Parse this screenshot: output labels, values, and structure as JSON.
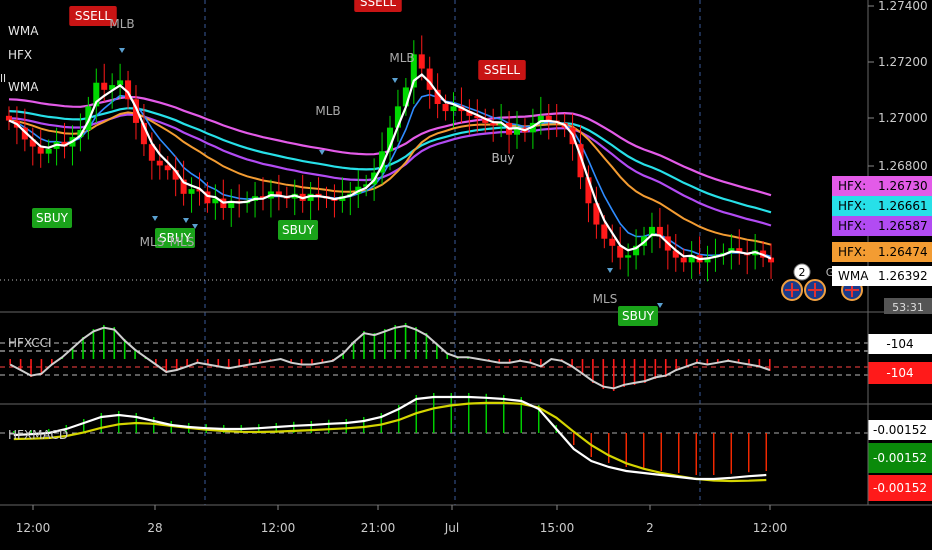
{
  "legend": {
    "line1": "WMA",
    "line2": "HFX",
    "line3": "WMA",
    "clipped": "ll"
  },
  "colors": {
    "bg": "#000000",
    "up": "#00d800",
    "down": "#ff1a1a",
    "wma_white": "#ffffff",
    "ema_blue": "#2f8cff",
    "ema_orange": "#f39c32",
    "ema_purple": "#b24bf3",
    "ema_pink": "#e35be8",
    "ema_cyan": "#27e0e8",
    "signal_sell": "#c81414",
    "signal_buy": "#1aa31a",
    "grid_dash": "#3a5a9a"
  },
  "price_axis": {
    "ticks": [
      "1.27400",
      "1.27200",
      "1.27000",
      "1.26800"
    ],
    "badges": [
      {
        "label": "HFX:",
        "value": "1.26730",
        "color": "#e35be8",
        "text": "#000"
      },
      {
        "label": "HFX:",
        "value": "1.26661",
        "color": "#27e0e8",
        "text": "#000"
      },
      {
        "label": "HFX:",
        "value": "1.26587",
        "color": "#b24bf3",
        "text": "#000"
      },
      {
        "label": "HFX:",
        "value": "1.26474",
        "color": "#f39c32",
        "text": "#000"
      },
      {
        "label": "WMA",
        "value": "1.26392",
        "color": "#ffffff",
        "text": "#000"
      }
    ],
    "countdown": "53:31"
  },
  "signals": [
    {
      "type": "SSELL",
      "kind": "sell"
    },
    {
      "type": "SSELL",
      "kind": "sell"
    },
    {
      "type": "SSELL",
      "kind": "sell"
    },
    {
      "type": "SBUY",
      "kind": "buy"
    },
    {
      "type": "SBUY",
      "kind": "buy"
    },
    {
      "type": "SBUY",
      "kind": "buy"
    },
    {
      "type": "SBUY",
      "kind": "buy"
    }
  ],
  "mlb_labels": [
    "MLB",
    "MLB",
    "MLB",
    "MLS",
    "MLS",
    "MLS"
  ],
  "buy_label": "Buy",
  "event_badge": "2",
  "event_badge_2": "G",
  "cci_panel": {
    "name": "HFXCCI",
    "scale": [
      "-104",
      "-104"
    ]
  },
  "macd_panel": {
    "name": "HFXMACD",
    "scale": [
      "-0.00152",
      "-0.00152",
      "-0.00152"
    ]
  },
  "time_axis": [
    "12:00",
    "28",
    "12:00",
    "21:00",
    "Jul",
    "15:00",
    "2",
    "12:00"
  ],
  "chart_data": {
    "type": "candlestick",
    "title": "",
    "ylabel": "",
    "ylim": [
      1.2618,
      1.275
    ],
    "closes": [
      1.2699,
      1.2696,
      1.2691,
      1.2688,
      1.2685,
      1.2687,
      1.269,
      1.2688,
      1.2692,
      1.2695,
      1.2705,
      1.2715,
      1.2712,
      1.2714,
      1.2716,
      1.2708,
      1.2698,
      1.2689,
      1.2682,
      1.268,
      1.2678,
      1.2674,
      1.2668,
      1.267,
      1.2669,
      1.2664,
      1.2666,
      1.2662,
      1.2665,
      1.2664,
      1.2665,
      1.2667,
      1.2666,
      1.2669,
      1.2667,
      1.2666,
      1.2668,
      1.2665,
      1.2668,
      1.2667,
      1.2666,
      1.2665,
      1.2667,
      1.2668,
      1.2671,
      1.2672,
      1.2677,
      1.2686,
      1.2696,
      1.2705,
      1.2713,
      1.2727,
      1.2721,
      1.2712,
      1.2706,
      1.2703,
      1.2705,
      1.2703,
      1.2701,
      1.27,
      1.2698,
      1.2697,
      1.2698,
      1.2693,
      1.2696,
      1.2694,
      1.2698,
      1.2701,
      1.2699,
      1.2698,
      1.2696,
      1.2689,
      1.2675,
      1.2664,
      1.2655,
      1.2649,
      1.2646,
      1.2641,
      1.2642,
      1.2646,
      1.265,
      1.2654,
      1.265,
      1.2644,
      1.2641,
      1.2639,
      1.2642,
      1.2639,
      1.2641,
      1.2642,
      1.2643,
      1.2645,
      1.2643,
      1.2642,
      1.2644,
      1.2641,
      1.2639
    ],
    "cci": [
      -0.3,
      -0.6,
      -0.9,
      -0.8,
      -0.3,
      0.1,
      0.6,
      1.1,
      1.5,
      1.7,
      1.6,
      1.0,
      0.5,
      0.1,
      -0.3,
      -0.7,
      -0.6,
      -0.4,
      -0.2,
      -0.3,
      -0.4,
      -0.5,
      -0.4,
      -0.3,
      -0.2,
      -0.1,
      0.0,
      -0.2,
      -0.3,
      -0.3,
      -0.2,
      -0.1,
      0.3,
      0.9,
      1.4,
      1.3,
      1.5,
      1.7,
      1.8,
      1.6,
      1.3,
      0.8,
      0.3,
      0.1,
      0.1,
      0.0,
      -0.1,
      -0.2,
      -0.2,
      -0.1,
      -0.2,
      -0.4,
      0.0,
      -0.1,
      -0.4,
      -0.8,
      -1.2,
      -1.5,
      -1.6,
      -1.4,
      -1.3,
      -1.2,
      -1.0,
      -0.9,
      -0.6,
      -0.4,
      -0.2,
      -0.3,
      -0.2,
      -0.1,
      -0.2,
      -0.3,
      -0.4,
      -0.6
    ],
    "macd": [
      0.05,
      0.07,
      0.1,
      0.2,
      0.35,
      0.5,
      0.55,
      0.5,
      0.4,
      0.3,
      0.25,
      0.22,
      0.2,
      0.2,
      0.22,
      0.25,
      0.28,
      0.3,
      0.33,
      0.35,
      0.4,
      0.5,
      0.7,
      0.95,
      1.0,
      1.0,
      1.0,
      0.98,
      0.95,
      0.9,
      0.7,
      0.2,
      -0.3,
      -0.6,
      -0.75,
      -0.85,
      -0.9,
      -0.95,
      -1.0,
      -1.05,
      -1.05,
      -1.02,
      -0.98,
      -0.95
    ]
  }
}
